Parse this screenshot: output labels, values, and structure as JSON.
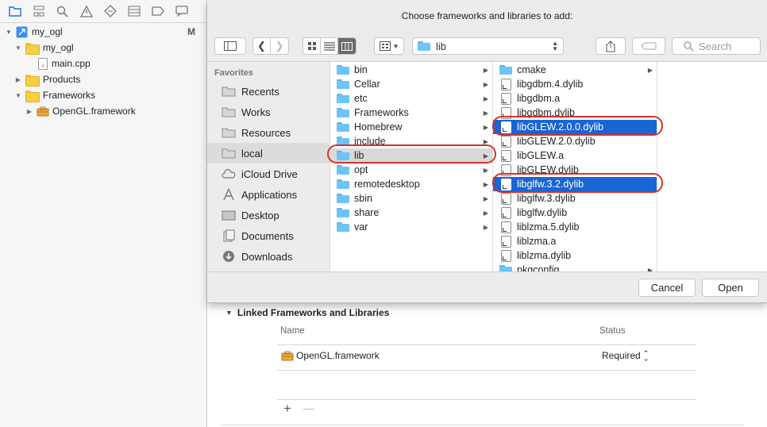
{
  "navigator": {
    "toolbar_icons": [
      "folder-icon",
      "hierarchy-icon",
      "search-icon",
      "warning-icon",
      "diamond-icon",
      "list-icon",
      "tag-icon",
      "comment-icon"
    ],
    "project_name": "my_ogl",
    "project_badge": "M",
    "group_name": "my_ogl",
    "file_main": "main.cpp",
    "products": "Products",
    "frameworks": "Frameworks",
    "opengl": "OpenGL.framework"
  },
  "dialog": {
    "title": "Choose frameworks and libraries to add:",
    "path": "lib",
    "search_placeholder": "Search",
    "sidebar": {
      "header": "Favorites",
      "items": [
        {
          "label": "Recents",
          "icon": "folder-icon"
        },
        {
          "label": "Works",
          "icon": "folder-icon"
        },
        {
          "label": "Resources",
          "icon": "folder-icon"
        },
        {
          "label": "local",
          "icon": "folder-icon"
        },
        {
          "label": "iCloud Drive",
          "icon": "cloud-icon"
        },
        {
          "label": "Applications",
          "icon": "applications-icon"
        },
        {
          "label": "Desktop",
          "icon": "desktop-icon"
        },
        {
          "label": "Documents",
          "icon": "documents-icon"
        },
        {
          "label": "Downloads",
          "icon": "downloads-icon"
        }
      ]
    },
    "column1": [
      "bin",
      "Cellar",
      "etc",
      "Frameworks",
      "Homebrew",
      "include",
      "lib",
      "opt",
      "remotedesktop",
      "sbin",
      "share",
      "var"
    ],
    "column2": [
      "cmake",
      "libgdbm.4.dylib",
      "libgdbm.a",
      "libgdbm.dylib",
      "libGLEW.2.0.0.dylib",
      "libGLEW.2.0.dylib",
      "libGLEW.a",
      "libGLEW.dylib",
      "libglfw.3.2.dylib",
      "libglfw.3.dylib",
      "libglfw.dylib",
      "liblzma.5.dylib",
      "liblzma.a",
      "liblzma.dylib",
      "pkgconfig"
    ],
    "cancel": "Cancel",
    "open": "Open"
  },
  "linked": {
    "title": "Linked Frameworks and Libraries",
    "col_name": "Name",
    "col_status": "Status",
    "row_name": "OpenGL.framework",
    "row_status": "Required",
    "add": "+",
    "remove": "—"
  },
  "colors": {
    "selection": "#1a65d4",
    "highlight_ring": "#d83229",
    "folder_blue": "#6cc4f8",
    "folder_yellow": "#f7cf43"
  }
}
